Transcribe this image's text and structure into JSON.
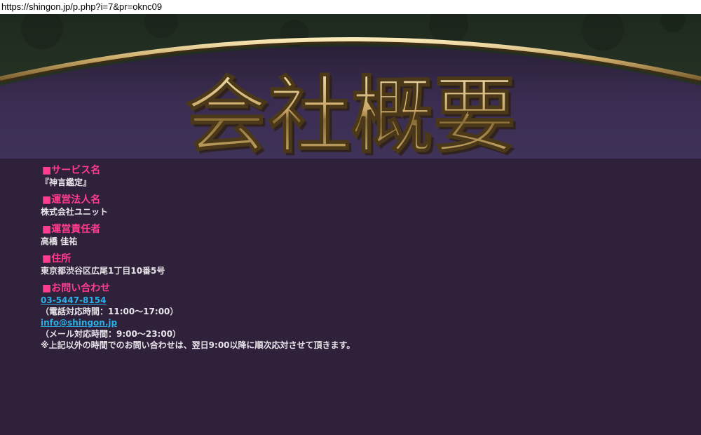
{
  "browser": {
    "url": "https://shingon.jp/p.php?i=7&pr=oknc09"
  },
  "banner": {
    "title": "会社概要"
  },
  "sections": [
    {
      "heading": "■サービス名",
      "value": "『神言鑑定』"
    },
    {
      "heading": "■運営法人名",
      "value": "株式会社ユニット"
    },
    {
      "heading": "■運営責任者",
      "value": "高橋 佳祐"
    },
    {
      "heading": "■住所",
      "value": "東京都渋谷区広尾1丁目10番5号"
    }
  ],
  "contact": {
    "heading": "■お問い合わせ",
    "phone": "03-5447-8154",
    "phone_hours": "（電話対応時間：11:00～17:00）",
    "email": "info@shingon.jp",
    "email_hours": "（メール対応時間：9:00～23:00）",
    "note": "※上記以外の時間でのお問い合わせは、翌日9:00以降に順次応対させて頂きます。"
  },
  "colors": {
    "background": "#2e2139",
    "heading": "#ff3c8e",
    "link": "#2ab0e6",
    "text": "#e8e4ea",
    "banner_gold": "#c9a968"
  }
}
